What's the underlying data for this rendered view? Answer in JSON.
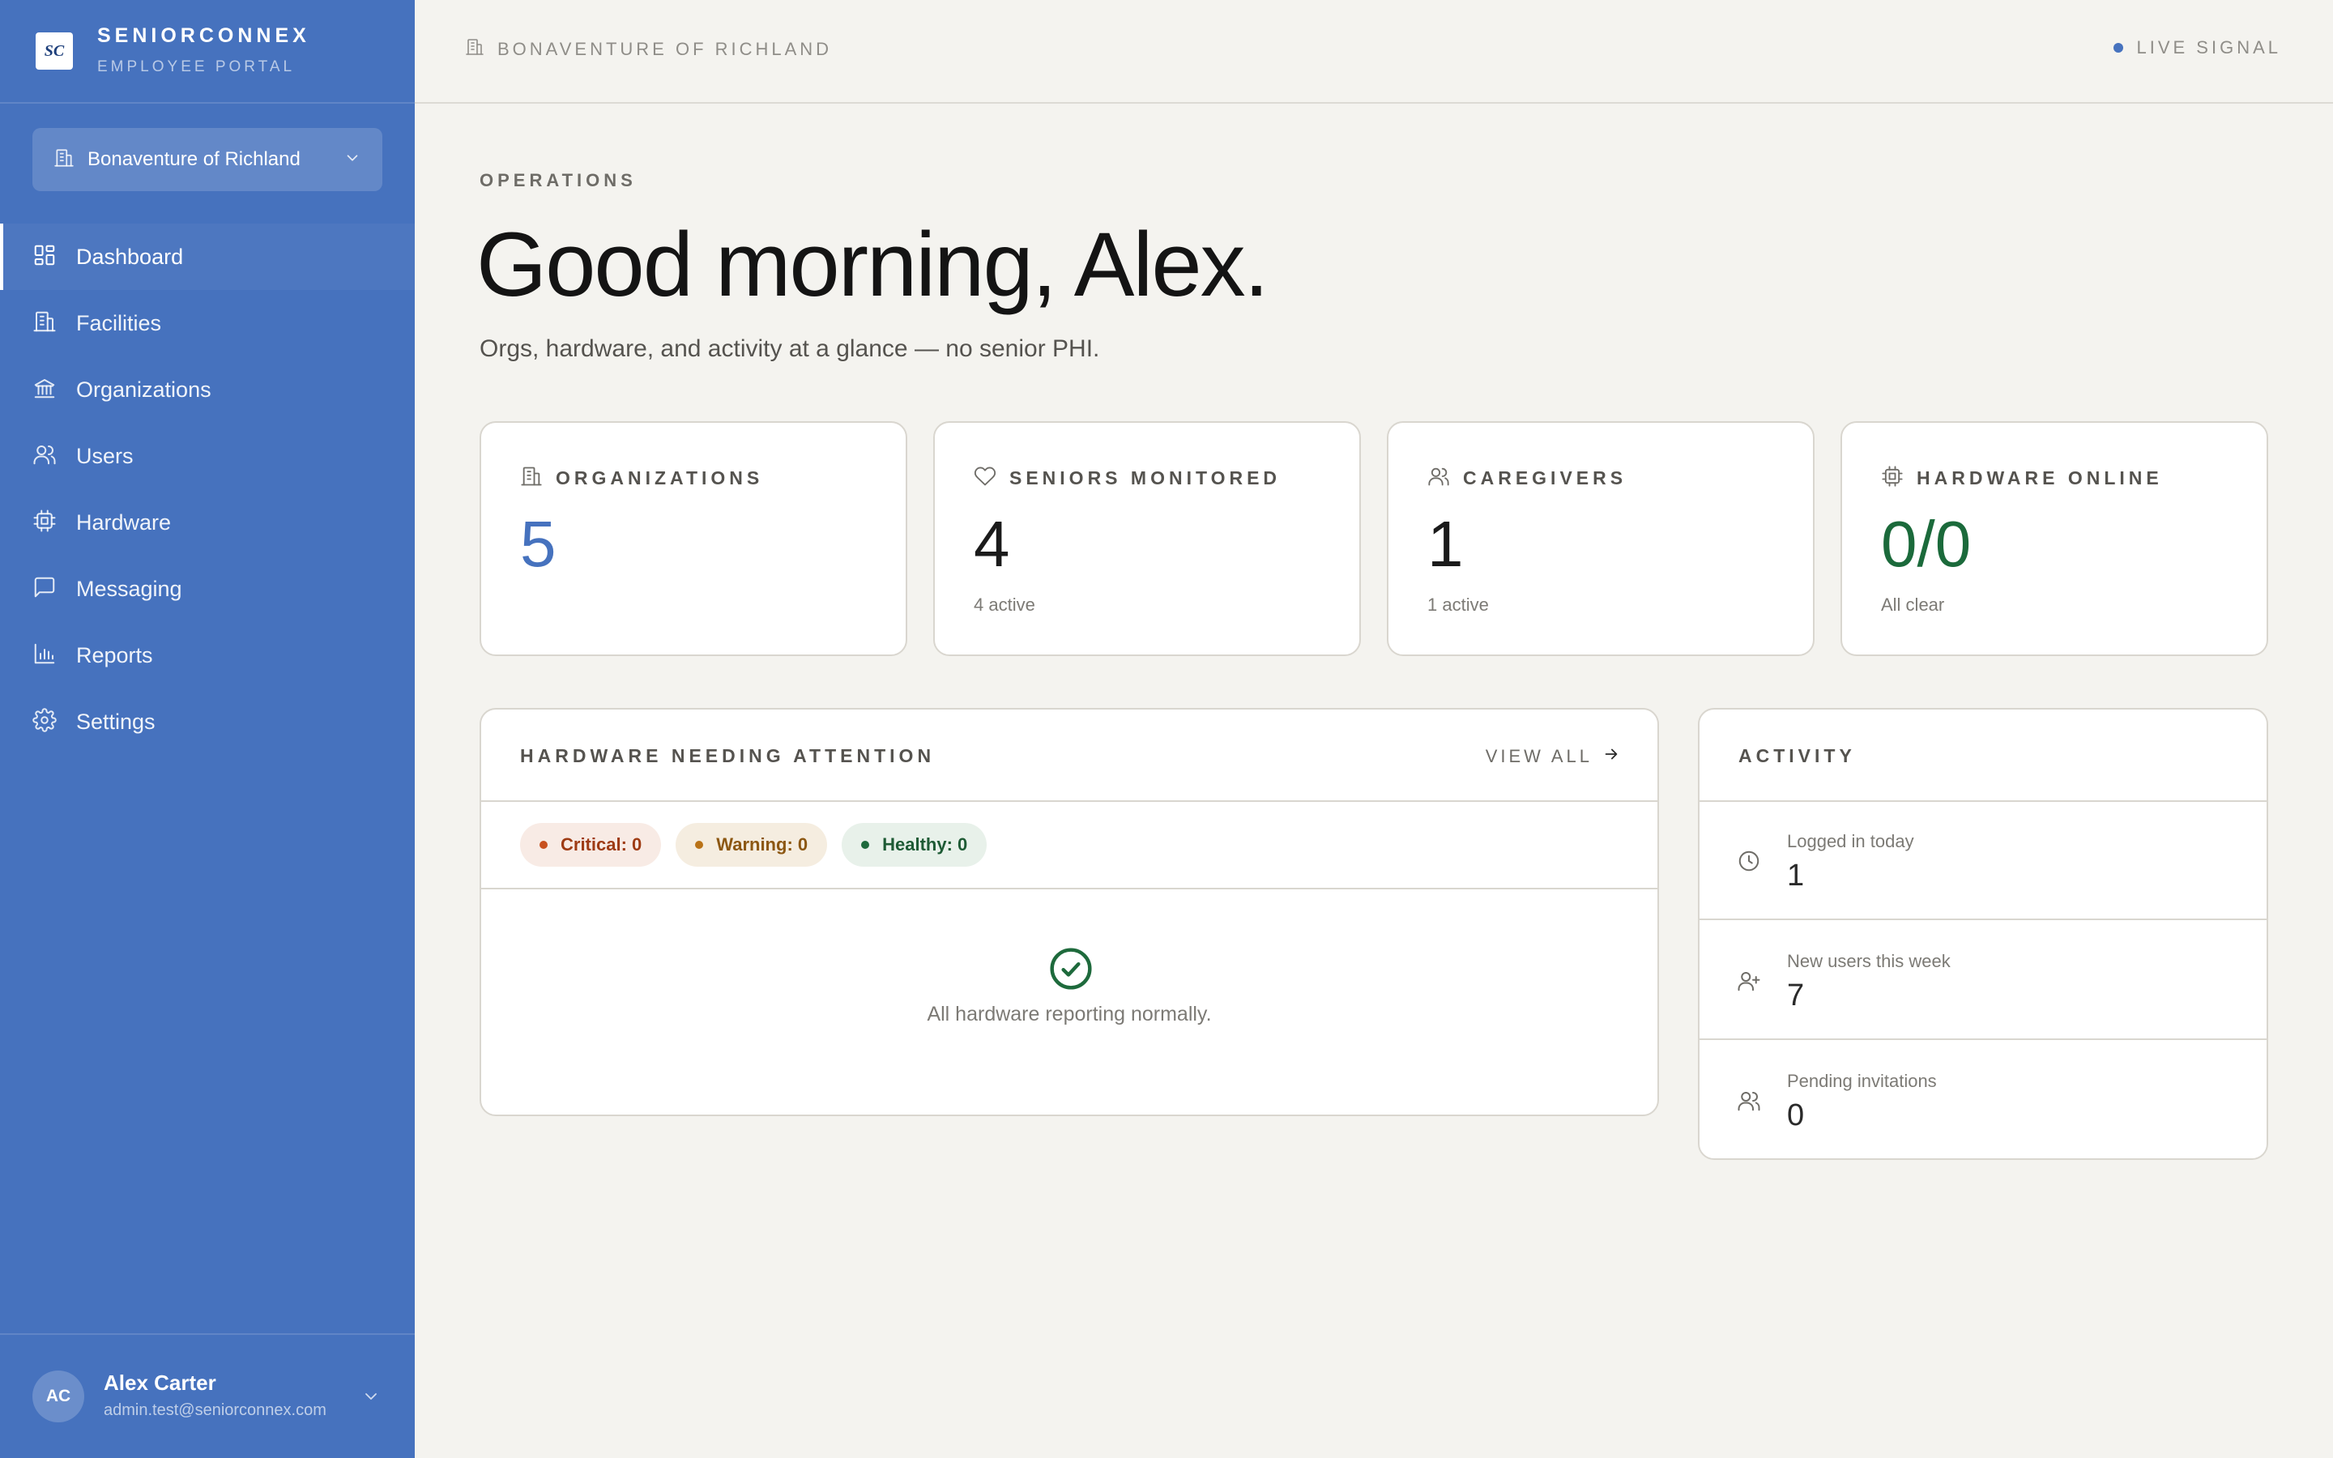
{
  "brand": {
    "logo_text": "SC",
    "name": "SENIORCONNEX",
    "subtitle": "EMPLOYEE PORTAL"
  },
  "facility_selector": {
    "value": "Bonaventure of Richland",
    "icon": "building-icon"
  },
  "nav": {
    "items": [
      {
        "label": "Dashboard",
        "icon": "dashboard-grid-icon",
        "active": true
      },
      {
        "label": "Facilities",
        "icon": "building-icon"
      },
      {
        "label": "Organizations",
        "icon": "institution-icon"
      },
      {
        "label": "Users",
        "icon": "users-icon"
      },
      {
        "label": "Hardware",
        "icon": "chip-icon"
      },
      {
        "label": "Messaging",
        "icon": "message-icon"
      },
      {
        "label": "Reports",
        "icon": "bar-chart-icon"
      },
      {
        "label": "Settings",
        "icon": "gear-icon"
      }
    ]
  },
  "user": {
    "initials": "AC",
    "name": "Alex Carter",
    "email": "admin.test@seniorconnex.com"
  },
  "topbar": {
    "breadcrumb": "BONAVENTURE OF RICHLAND",
    "status": "LIVE SIGNAL"
  },
  "header": {
    "eyebrow": "OPERATIONS",
    "greeting": "Good morning, Alex.",
    "subtitle": "Orgs, hardware, and activity at a glance — no senior PHI."
  },
  "stats": [
    {
      "title": "ORGANIZATIONS",
      "value": "5",
      "sub": "",
      "icon": "building-icon"
    },
    {
      "title": "SENIORS MONITORED",
      "value": "4",
      "sub": "4 active",
      "icon": "heart-icon"
    },
    {
      "title": "CAREGIVERS",
      "value": "1",
      "sub": "1 active",
      "icon": "users-icon"
    },
    {
      "title": "HARDWARE ONLINE",
      "value": "0/0",
      "sub": "All clear",
      "icon": "chip-icon"
    }
  ],
  "hardware_panel": {
    "title": "HARDWARE NEEDING ATTENTION",
    "view_all": "VIEW ALL",
    "chips": {
      "critical": "Critical: 0",
      "warning": "Warning: 0",
      "healthy": "Healthy: 0"
    },
    "empty_message": "All hardware reporting normally."
  },
  "activity": {
    "title": "ACTIVITY",
    "rows": [
      {
        "label": "Logged in today",
        "value": "1",
        "icon": "clock-icon"
      },
      {
        "label": "New users this week",
        "value": "7",
        "icon": "user-plus-icon"
      },
      {
        "label": "Pending invitations",
        "value": "0",
        "icon": "users-icon"
      }
    ]
  },
  "colors": {
    "sidebar": "#4672be",
    "background": "#f4f3ef",
    "accent_blue": "#4672be",
    "accent_green": "#1b6a3b",
    "critical": "#c8501e",
    "warning": "#b97318",
    "healthy": "#1e6a3c"
  }
}
